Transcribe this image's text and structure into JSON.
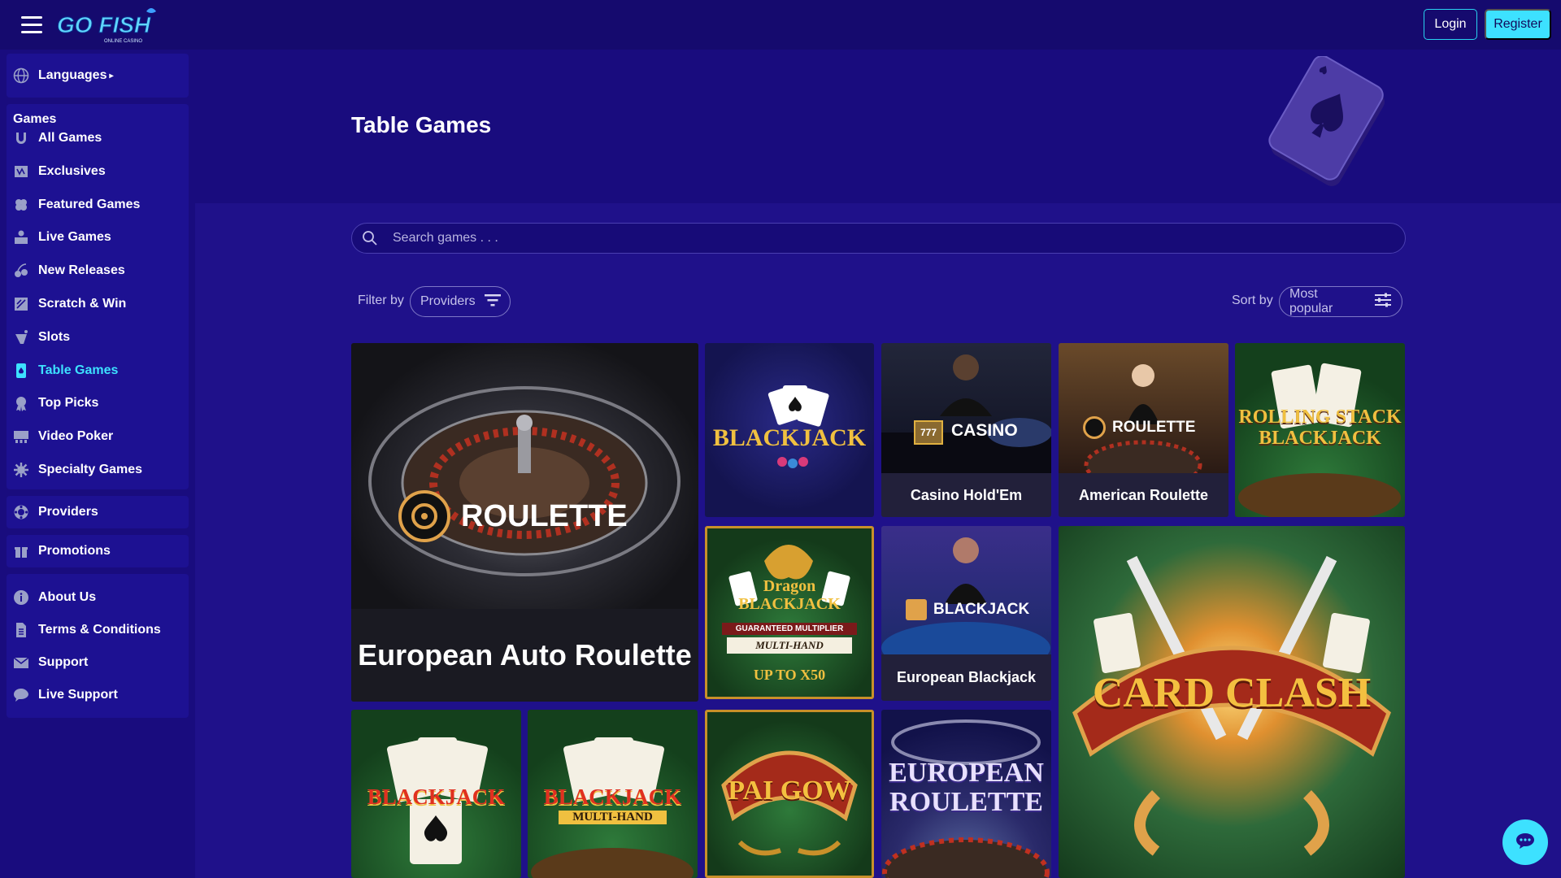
{
  "header": {
    "logo_text": "GO FISH",
    "logo_sub": "ONLINE CASINO",
    "login_label": "Login",
    "register_label": "Register"
  },
  "sidebar": {
    "languages_label": "Languages",
    "games_heading": "Games",
    "game_items": [
      {
        "label": "All Games",
        "icon": "horseshoe-icon"
      },
      {
        "label": "Exclusives",
        "icon": "exclusive-icon"
      },
      {
        "label": "Featured Games",
        "icon": "clover-icon"
      },
      {
        "label": "Live Games",
        "icon": "dealer-icon"
      },
      {
        "label": "New Releases",
        "icon": "cherries-icon"
      },
      {
        "label": "Scratch & Win",
        "icon": "scratch-icon"
      },
      {
        "label": "Slots",
        "icon": "slot-lever-icon"
      },
      {
        "label": "Table Games",
        "icon": "card-icon",
        "active": true
      },
      {
        "label": "Top Picks",
        "icon": "award-icon"
      },
      {
        "label": "Video Poker",
        "icon": "video-poker-icon"
      },
      {
        "label": "Specialty Games",
        "icon": "gear-icon"
      }
    ],
    "providers_label": "Providers",
    "promotions_label": "Promotions",
    "info_items": [
      {
        "label": "About Us",
        "icon": "info-icon"
      },
      {
        "label": "Terms & Conditions",
        "icon": "document-icon"
      },
      {
        "label": "Support",
        "icon": "mail-icon"
      },
      {
        "label": "Live Support",
        "icon": "chat-bubble-icon"
      }
    ]
  },
  "page": {
    "title": "Table Games",
    "search_placeholder": "Search games . . .",
    "filter_label": "Filter by",
    "filter_value": "Providers",
    "sort_label": "Sort by",
    "sort_value": "Most popular"
  },
  "games": [
    {
      "title": "European Auto Roulette",
      "art_label": "ROULETTE"
    },
    {
      "art_label": "BLACKJACK"
    },
    {
      "title": "Casino Hold'Em",
      "art_label": "CASINO"
    },
    {
      "title": "American Roulette",
      "art_label": "ROULETTE"
    },
    {
      "art_label": "ROLLING STACK BLACKJACK"
    },
    {
      "art_label": "Dragon BLACKJACK",
      "art_sub": "GUARANTEED MULTIPLIER",
      "art_sub2": "MULTI-HAND",
      "art_sub3": "UP TO X50"
    },
    {
      "title": "European Blackjack",
      "art_label": "BLACKJACK"
    },
    {
      "art_label": "CARD CLASH"
    },
    {
      "art_label": "BLACKJACK"
    },
    {
      "art_label": "BLACKJACK",
      "art_sub": "MULTI-HAND"
    },
    {
      "art_label": "PAI GOW"
    },
    {
      "art_label": "EUROPEAN ROULETTE"
    }
  ],
  "colors": {
    "background": "#1f118a",
    "topbar": "#150a6e",
    "accent": "#3de1ff"
  }
}
